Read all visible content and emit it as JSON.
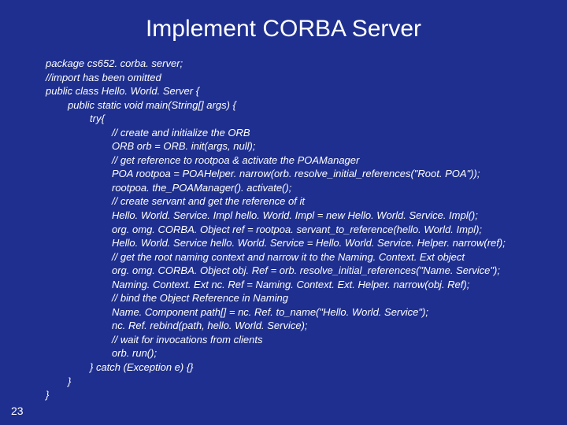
{
  "slide": {
    "title": "Implement CORBA Server",
    "page_number": "23"
  },
  "code": {
    "lines": [
      {
        "indent": 0,
        "text": "package cs652. corba. server;"
      },
      {
        "indent": 0,
        "text": "//import has been omitted"
      },
      {
        "indent": 0,
        "text": "public class Hello. World. Server {"
      },
      {
        "indent": 1,
        "text": "public static void main(String[] args) {"
      },
      {
        "indent": 2,
        "text": "try{"
      },
      {
        "indent": 3,
        "text": "// create and initialize the ORB"
      },
      {
        "indent": 3,
        "text": "ORB orb = ORB. init(args, null);"
      },
      {
        "indent": 3,
        "text": "// get reference to rootpoa & activate the POAManager"
      },
      {
        "indent": 3,
        "text": "POA rootpoa = POAHelper. narrow(orb. resolve_initial_references(\"Root. POA\"));"
      },
      {
        "indent": 3,
        "text": "rootpoa. the_POAManager(). activate();"
      },
      {
        "indent": 3,
        "text": "// create servant and get the reference of it"
      },
      {
        "indent": 3,
        "text": "Hello. World. Service. Impl hello. World. Impl = new Hello. World. Service. Impl();"
      },
      {
        "indent": 3,
        "text": "org. omg. CORBA. Object ref = rootpoa. servant_to_reference(hello. World. Impl);"
      },
      {
        "indent": 3,
        "text": "Hello. World. Service hello. World. Service = Hello. World. Service. Helper. narrow(ref);"
      },
      {
        "indent": 3,
        "text": "// get the root naming context and narrow it to the Naming. Context. Ext object"
      },
      {
        "indent": 3,
        "text": "org. omg. CORBA. Object obj. Ref = orb. resolve_initial_references(\"Name. Service\");"
      },
      {
        "indent": 3,
        "text": "Naming. Context. Ext nc. Ref = Naming. Context. Ext. Helper. narrow(obj. Ref);"
      },
      {
        "indent": 3,
        "text": "// bind the Object Reference in Naming"
      },
      {
        "indent": 3,
        "text": "Name. Component path[] = nc. Ref. to_name(\"Hello. World. Service\");"
      },
      {
        "indent": 3,
        "text": "nc. Ref. rebind(path, hello. World. Service);"
      },
      {
        "indent": 3,
        "text": "// wait for invocations from clients"
      },
      {
        "indent": 3,
        "text": "orb. run();"
      },
      {
        "indent": 2,
        "text": "} catch (Exception e) {}"
      },
      {
        "indent": 1,
        "text": "}"
      },
      {
        "indent": 0,
        "text": "}"
      }
    ]
  }
}
